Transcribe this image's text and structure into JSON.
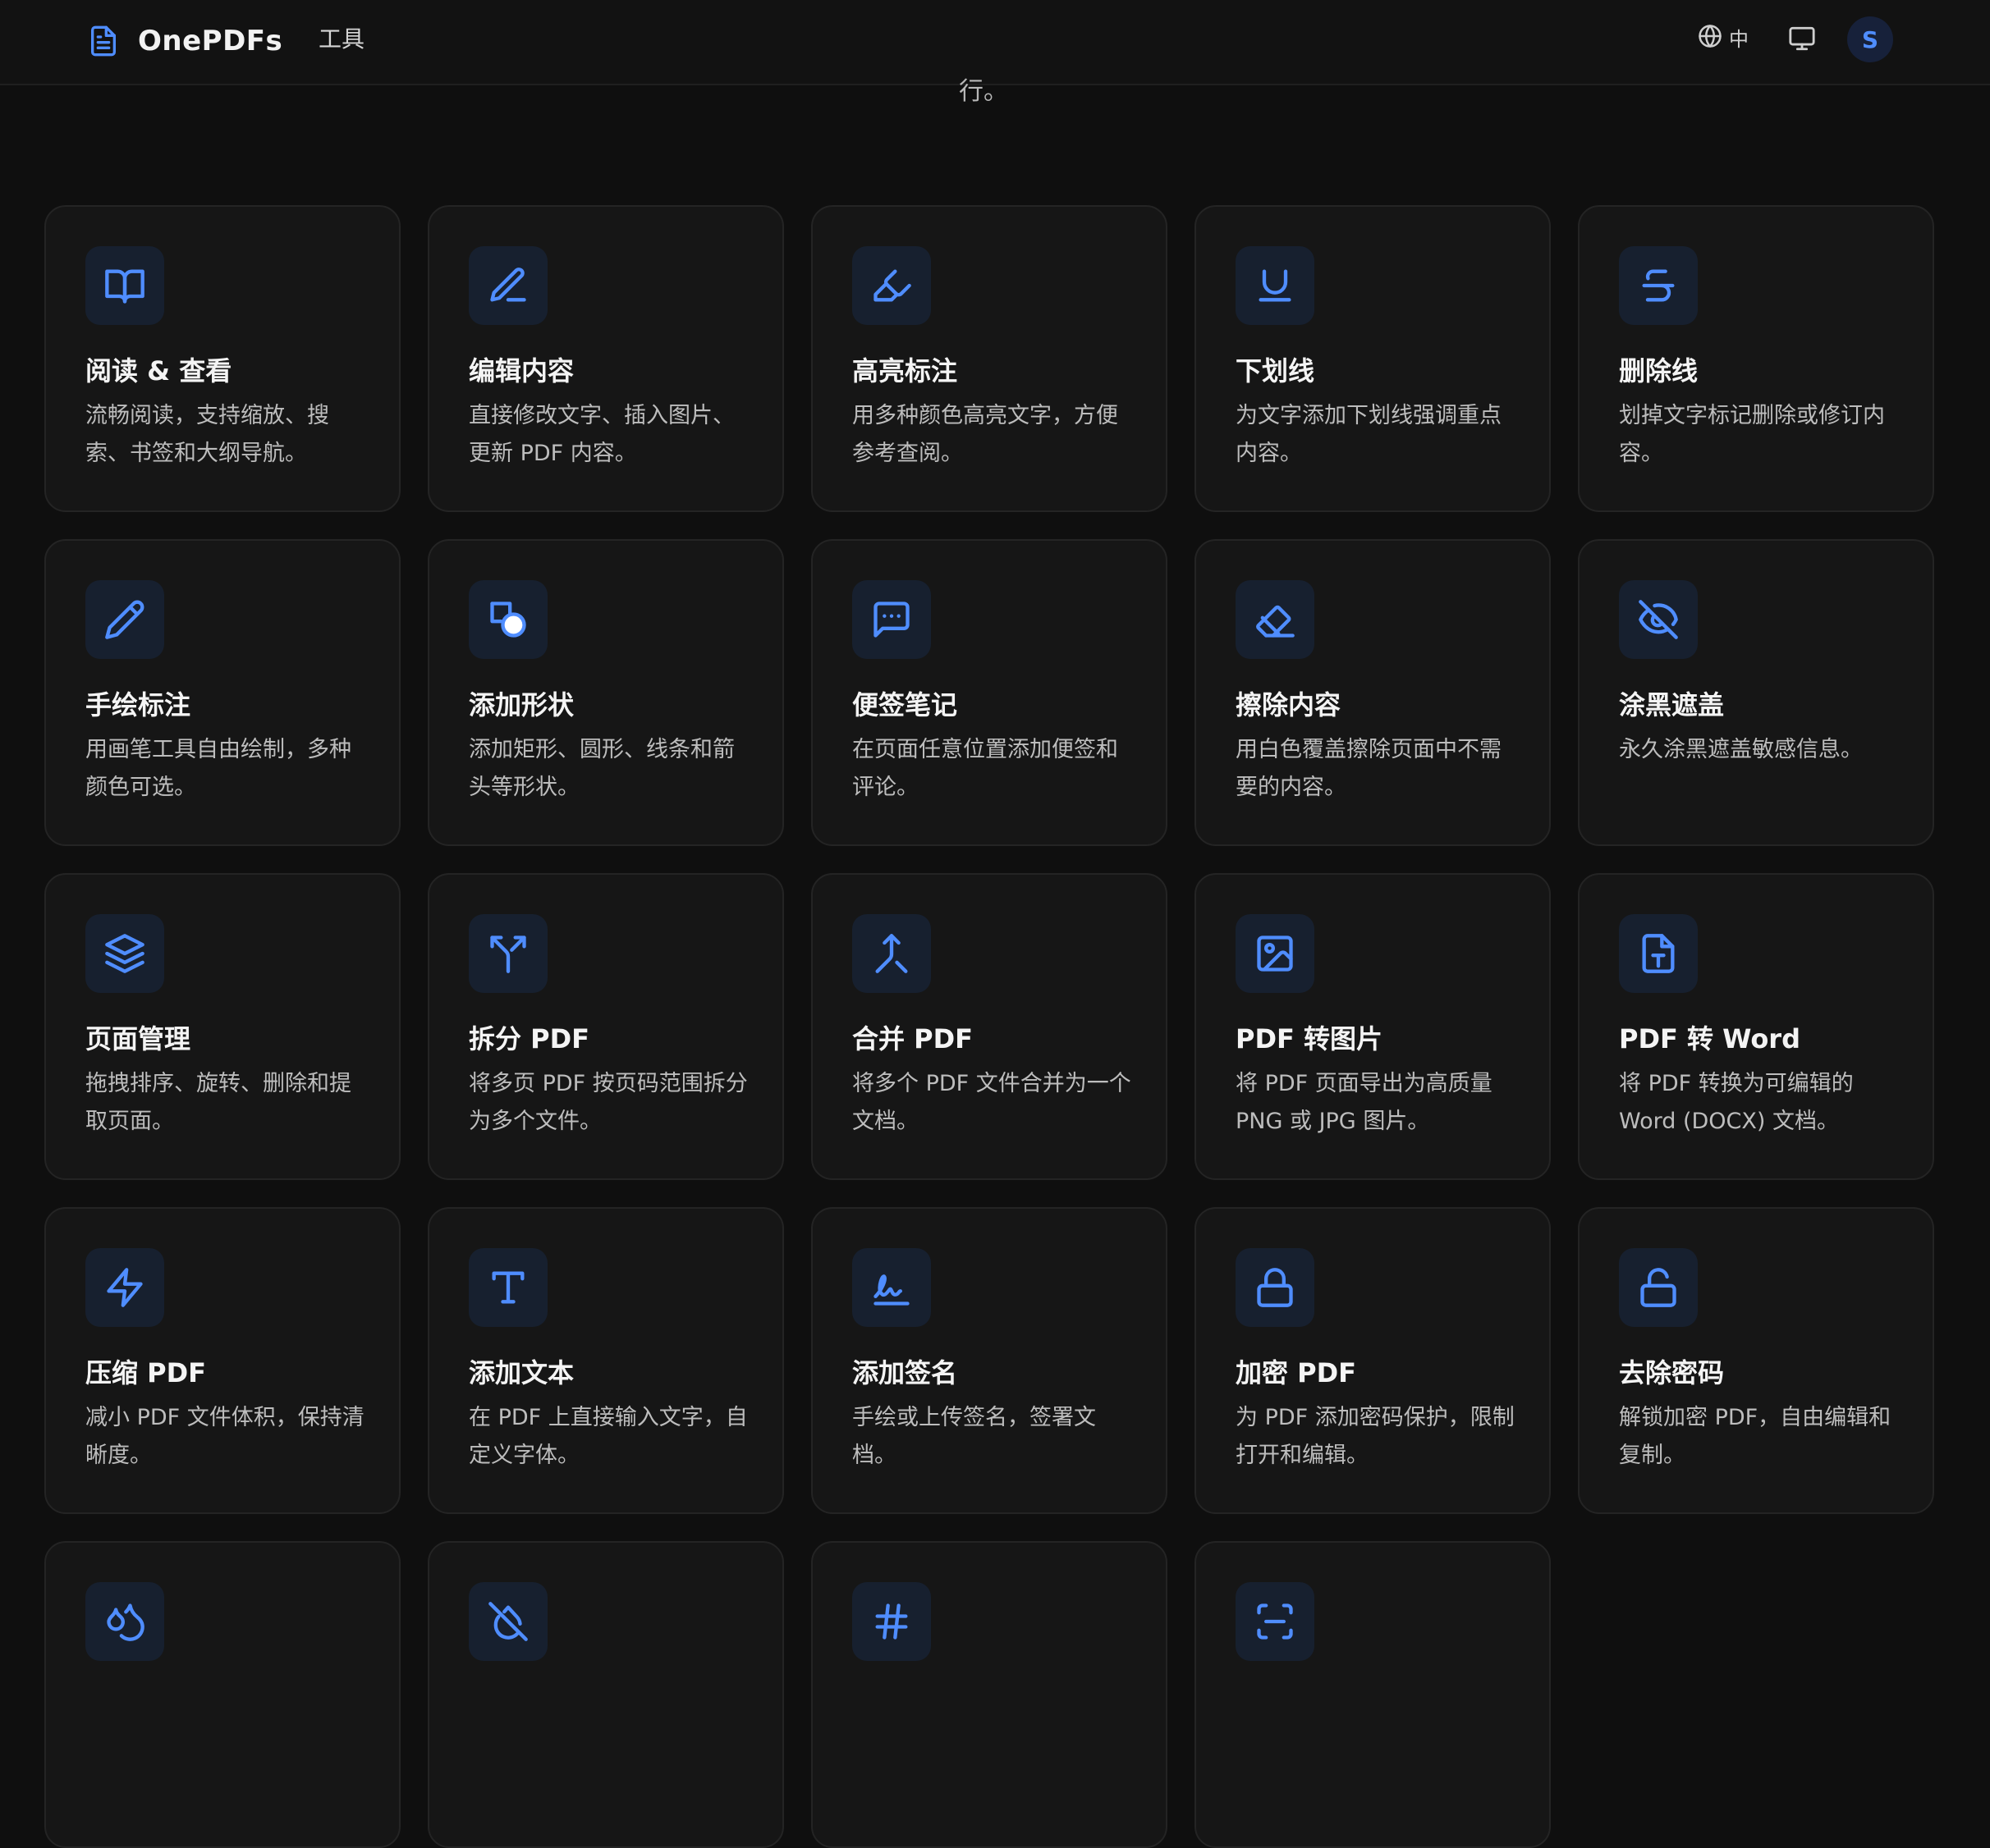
{
  "header": {
    "brand": "OnePDFs",
    "nav_tools": "工具",
    "lang": "中",
    "avatar_initial": "S"
  },
  "subtitle_fragment": "行。",
  "accent": "#4f8dff",
  "tools": [
    {
      "title": "阅读 & 查看",
      "desc": "流畅阅读，支持缩放、搜索、书签和大纲导航。",
      "icon": "book-open-icon"
    },
    {
      "title": "编辑内容",
      "desc": "直接修改文字、插入图片、更新 PDF 内容。",
      "icon": "pen-icon"
    },
    {
      "title": "高亮标注",
      "desc": "用多种颜色高亮文字，方便参考查阅。",
      "icon": "highlighter-icon"
    },
    {
      "title": "下划线",
      "desc": "为文字添加下划线强调重点内容。",
      "icon": "underline-icon"
    },
    {
      "title": "删除线",
      "desc": "划掉文字标记删除或修订内容。",
      "icon": "strikethrough-icon"
    },
    {
      "title": "手绘标注",
      "desc": "用画笔工具自由绘制，多种颜色可选。",
      "icon": "pencil-icon"
    },
    {
      "title": "添加形状",
      "desc": "添加矩形、圆形、线条和箭头等形状。",
      "icon": "shapes-icon"
    },
    {
      "title": "便签笔记",
      "desc": "在页面任意位置添加便签和评论。",
      "icon": "message-icon"
    },
    {
      "title": "擦除内容",
      "desc": "用白色覆盖擦除页面中不需要的内容。",
      "icon": "eraser-icon"
    },
    {
      "title": "涂黑遮盖",
      "desc": "永久涂黑遮盖敏感信息。",
      "icon": "eye-off-icon"
    },
    {
      "title": "页面管理",
      "desc": "拖拽排序、旋转、删除和提取页面。",
      "icon": "layers-icon"
    },
    {
      "title": "拆分 PDF",
      "desc": "将多页 PDF 按页码范围拆分为多个文件。",
      "icon": "split-icon"
    },
    {
      "title": "合并 PDF",
      "desc": "将多个 PDF 文件合并为一个文档。",
      "icon": "merge-icon"
    },
    {
      "title": "PDF 转图片",
      "desc": "将 PDF 页面导出为高质量 PNG 或 JPG 图片。",
      "icon": "image-icon"
    },
    {
      "title": "PDF 转 Word",
      "desc": "将 PDF 转换为可编辑的 Word (DOCX) 文档。",
      "icon": "file-type-icon"
    },
    {
      "title": "压缩 PDF",
      "desc": "减小 PDF 文件体积，保持清晰度。",
      "icon": "zap-icon"
    },
    {
      "title": "添加文本",
      "desc": "在 PDF 上直接输入文字，自定义字体。",
      "icon": "type-icon"
    },
    {
      "title": "添加签名",
      "desc": "手绘或上传签名，签署文档。",
      "icon": "signature-icon"
    },
    {
      "title": "加密 PDF",
      "desc": "为 PDF 添加密码保护，限制打开和编辑。",
      "icon": "lock-icon"
    },
    {
      "title": "去除密码",
      "desc": "解锁加密 PDF，自由编辑和复制。",
      "icon": "lock-open-icon"
    },
    {
      "title": "",
      "desc": "",
      "icon": "droplets-icon"
    },
    {
      "title": "",
      "desc": "",
      "icon": "droplet-off-icon"
    },
    {
      "title": "",
      "desc": "",
      "icon": "hash-icon"
    },
    {
      "title": "",
      "desc": "",
      "icon": "scan-text-icon"
    }
  ]
}
